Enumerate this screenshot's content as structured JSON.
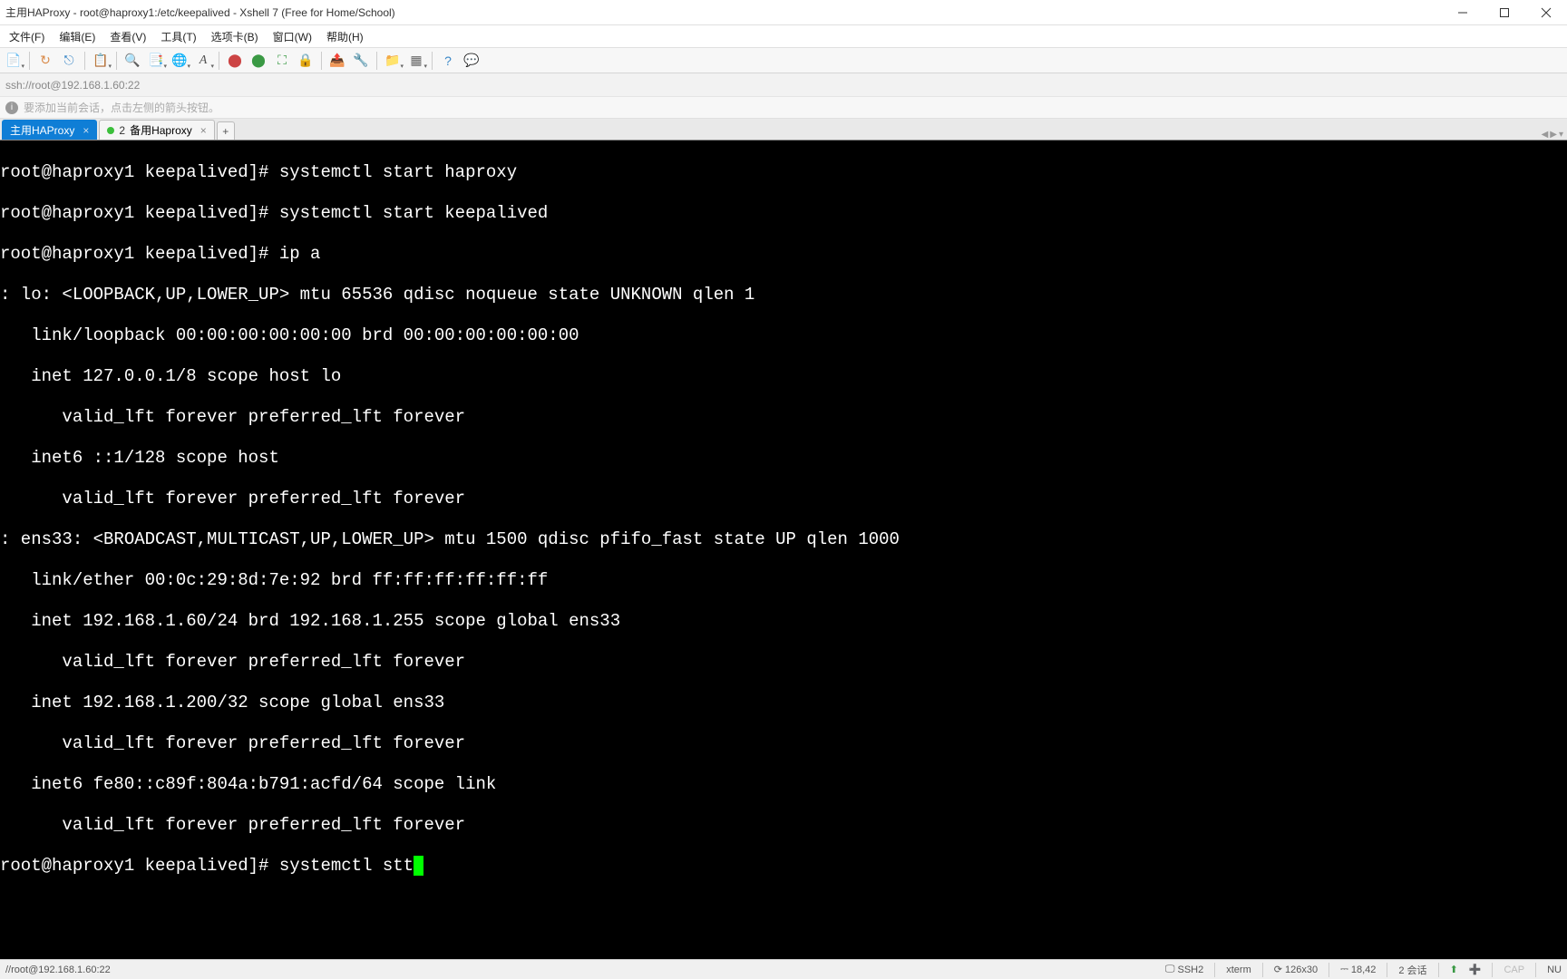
{
  "window": {
    "title": "主用HAProxy - root@haproxy1:/etc/keepalived - Xshell 7 (Free for Home/School)"
  },
  "menu": {
    "file": "文件(F)",
    "edit": "编辑(E)",
    "view": "查看(V)",
    "tools": "工具(T)",
    "tabs": "选项卡(B)",
    "window": "窗口(W)",
    "help": "帮助(H)"
  },
  "address": {
    "text": "ssh://root@192.168.1.60:22"
  },
  "hint": {
    "text": "要添加当前会话，点击左侧的箭头按钮。"
  },
  "tabs": {
    "active": "主用HAProxy",
    "tab2_prefix": "● 2",
    "tab2_label": "备用Haproxy",
    "add": "+"
  },
  "terminal": {
    "l1": "root@haproxy1 keepalived]# systemctl start haproxy",
    "l2": "root@haproxy1 keepalived]# systemctl start keepalived",
    "l3": "root@haproxy1 keepalived]# ip a",
    "l4": ": lo: <LOOPBACK,UP,LOWER_UP> mtu 65536 qdisc noqueue state UNKNOWN qlen 1",
    "l5": "   link/loopback 00:00:00:00:00:00 brd 00:00:00:00:00:00",
    "l6": "   inet 127.0.0.1/8 scope host lo",
    "l7": "      valid_lft forever preferred_lft forever",
    "l8": "   inet6 ::1/128 scope host",
    "l9": "      valid_lft forever preferred_lft forever",
    "l10": ": ens33: <BROADCAST,MULTICAST,UP,LOWER_UP> mtu 1500 qdisc pfifo_fast state UP qlen 1000",
    "l11": "   link/ether 00:0c:29:8d:7e:92 brd ff:ff:ff:ff:ff:ff",
    "l12": "   inet 192.168.1.60/24 brd 192.168.1.255 scope global ens33",
    "l13": "      valid_lft forever preferred_lft forever",
    "l14": "   inet 192.168.1.200/32 scope global ens33",
    "l15": "      valid_lft forever preferred_lft forever",
    "l16": "   inet6 fe80::c89f:804a:b791:acfd/64 scope link",
    "l17": "      valid_lft forever preferred_lft forever",
    "l18": "root@haproxy1 keepalived]# systemctl stt"
  },
  "status": {
    "path": "//root@192.168.1.60:22",
    "ssh": "SSH2",
    "term_type": "xterm",
    "size": "126x30",
    "cursor": "18,42",
    "sessions": "2 会话",
    "cap": "CAP",
    "num": "NU"
  }
}
